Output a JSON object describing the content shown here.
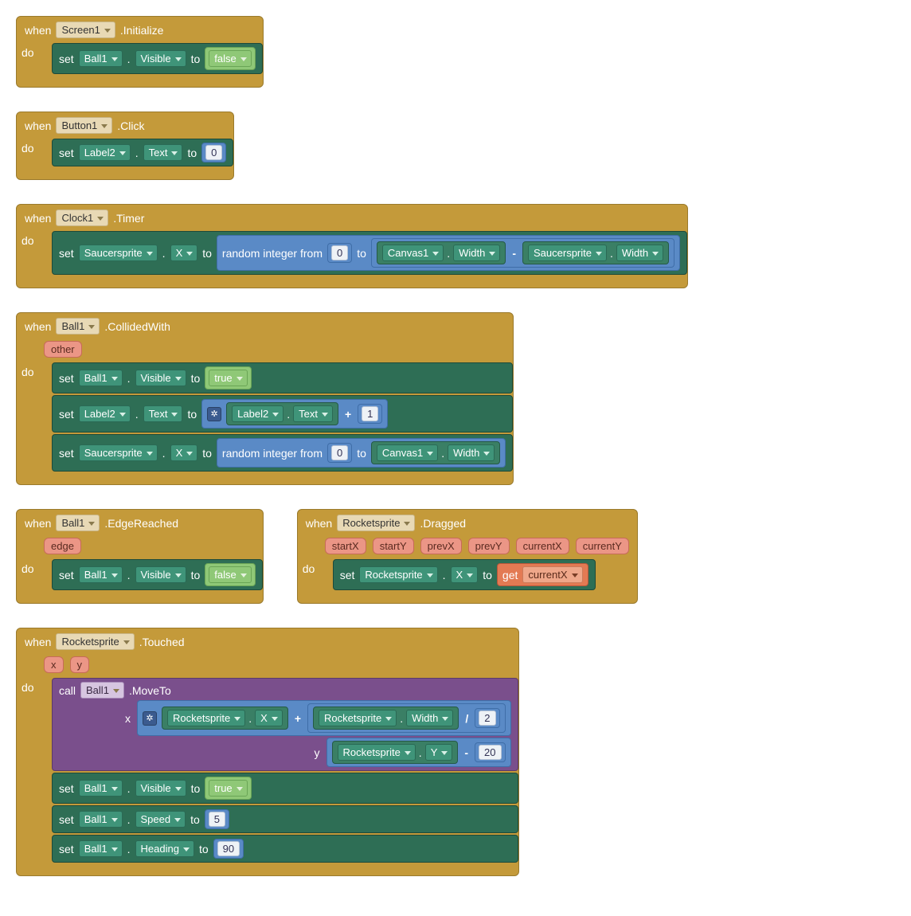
{
  "kw": {
    "when": "when",
    "do": "do",
    "set": "set",
    "to": "to",
    "call": "call",
    "get": "get",
    "dot": "."
  },
  "math": {
    "random_from": "random integer from",
    "random_to": "to",
    "plus": "+",
    "minus": "-",
    "div": "/"
  },
  "blocks": {
    "b1": {
      "event": {
        "comp": "Screen1",
        "name": ".Initialize"
      },
      "s1": {
        "comp": "Ball1",
        "prop": "Visible",
        "val": "false"
      }
    },
    "b2": {
      "event": {
        "comp": "Button1",
        "name": ".Click"
      },
      "s1": {
        "comp": "Label2",
        "prop": "Text",
        "val": "0"
      }
    },
    "b3": {
      "event": {
        "comp": "Clock1",
        "name": ".Timer"
      },
      "s1": {
        "comp": "Saucersprite",
        "prop": "X",
        "rand_from": "0",
        "sub_l": {
          "comp": "Canvas1",
          "prop": "Width"
        },
        "sub_r": {
          "comp": "Saucersprite",
          "prop": "Width"
        }
      }
    },
    "b4": {
      "event": {
        "comp": "Ball1",
        "name": ".CollidedWith"
      },
      "params": [
        "other"
      ],
      "s1": {
        "comp": "Ball1",
        "prop": "Visible",
        "val": "true"
      },
      "s2": {
        "comp": "Label2",
        "prop": "Text",
        "add_l": {
          "comp": "Label2",
          "prop": "Text"
        },
        "add_r": "1"
      },
      "s3": {
        "comp": "Saucersprite",
        "prop": "X",
        "rand_from": "0",
        "rand_to": {
          "comp": "Canvas1",
          "prop": "Width"
        }
      }
    },
    "b5": {
      "event": {
        "comp": "Ball1",
        "name": ".EdgeReached"
      },
      "params": [
        "edge"
      ],
      "s1": {
        "comp": "Ball1",
        "prop": "Visible",
        "val": "false"
      }
    },
    "b6": {
      "event": {
        "comp": "Rocketsprite",
        "name": ".Dragged"
      },
      "params": [
        "startX",
        "startY",
        "prevX",
        "prevY",
        "currentX",
        "currentY"
      ],
      "s1": {
        "comp": "Rocketsprite",
        "prop": "X",
        "getvar": "currentX"
      }
    },
    "b7": {
      "event": {
        "comp": "Rocketsprite",
        "name": ".Touched"
      },
      "params": [
        "x",
        "y"
      ],
      "call": {
        "comp": "Ball1",
        "method": ".MoveTo",
        "x": {
          "add_l": {
            "comp": "Rocketsprite",
            "prop": "X"
          },
          "div_l": {
            "comp": "Rocketsprite",
            "prop": "Width"
          },
          "div_r": "2"
        },
        "y": {
          "sub_l": {
            "comp": "Rocketsprite",
            "prop": "Y"
          },
          "sub_r": "20"
        },
        "arg_x_label": "x",
        "arg_y_label": "y"
      },
      "s2": {
        "comp": "Ball1",
        "prop": "Visible",
        "val": "true"
      },
      "s3": {
        "comp": "Ball1",
        "prop": "Speed",
        "val": "5"
      },
      "s4": {
        "comp": "Ball1",
        "prop": "Heading",
        "val": "90"
      }
    }
  }
}
